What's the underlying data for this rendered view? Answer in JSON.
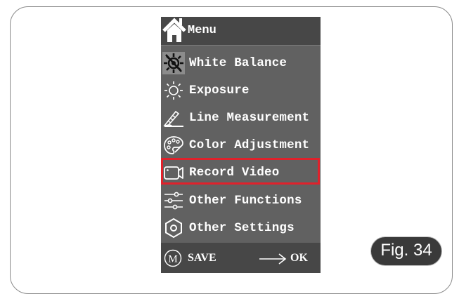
{
  "menu": {
    "title": "Menu",
    "items": [
      {
        "label": "White Balance",
        "icon": "white-balance-icon"
      },
      {
        "label": "Exposure",
        "icon": "exposure-sun-icon"
      },
      {
        "label": "Line Measurement",
        "icon": "ruler-measure-icon"
      },
      {
        "label": "Color Adjustment",
        "icon": "palette-icon"
      },
      {
        "label": "Record Video",
        "icon": "video-camera-icon"
      },
      {
        "label": "Other Functions",
        "icon": "sliders-icon"
      },
      {
        "label": "Other Settings",
        "icon": "settings-hex-icon"
      }
    ],
    "selected_index": 0,
    "highlighted_label": "Record Video"
  },
  "footer": {
    "m_key": "M",
    "save_label": "SAVE",
    "ok_label": "OK"
  },
  "figure_label": "Fig. 34",
  "colors": {
    "menu_bg": "#616161",
    "header_bg": "#474747",
    "highlight": "#e0212b",
    "text": "#ffffff"
  }
}
